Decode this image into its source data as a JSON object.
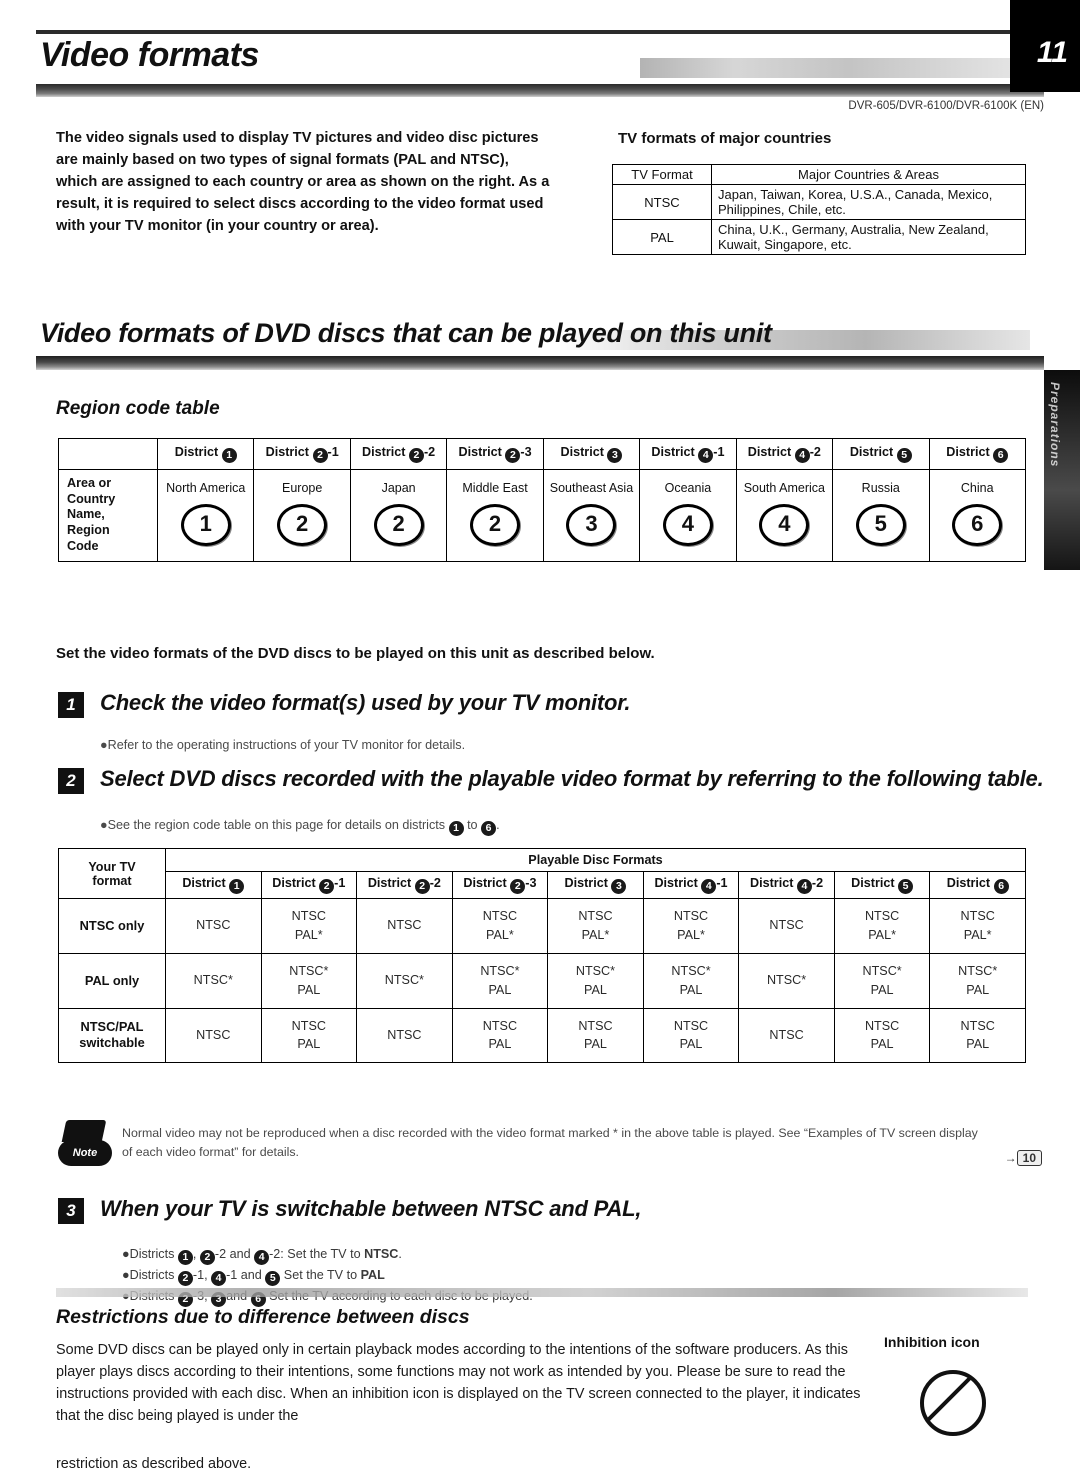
{
  "header": {
    "title": "Video formats",
    "page_number": "11",
    "model_line": "DVR-605/DVR-6100/DVR-6100K (EN)"
  },
  "intro": {
    "text": "The video signals used to display TV pictures and video disc pictures are mainly based on two types of signal formats (PAL and NTSC), which are assigned to each country or area as shown on the right. As a result, it is required to select discs according to the video format used with your TV monitor (in your country or area)."
  },
  "tv_formats": {
    "title": "TV formats of major countries",
    "headers": [
      "TV Format",
      "Major Countries & Areas"
    ],
    "rows": [
      {
        "format": "NTSC",
        "areas_line1": "Japan, Taiwan, Korea, U.S.A., Canada, Mexico,",
        "areas_line2": "Philippines, Chile, etc."
      },
      {
        "format": "PAL",
        "areas_line1": "China, U.K., Germany, Australia, New Zealand,",
        "areas_line2": "Kuwait, Singapore, etc."
      }
    ]
  },
  "banner": {
    "title": "Video formats of DVD discs that can be played on this unit"
  },
  "side_tab": {
    "label": "Preparations"
  },
  "region_table": {
    "heading": "Region code table",
    "row_label": "Area or Country Name, Region Code",
    "districts": [
      {
        "label": "District",
        "badge": "1",
        "sub": ""
      },
      {
        "label": "District",
        "badge": "2",
        "sub": "-1"
      },
      {
        "label": "District",
        "badge": "2",
        "sub": "-2"
      },
      {
        "label": "District",
        "badge": "2",
        "sub": "-3"
      },
      {
        "label": "District",
        "badge": "3",
        "sub": ""
      },
      {
        "label": "District",
        "badge": "4",
        "sub": "-1"
      },
      {
        "label": "District",
        "badge": "4",
        "sub": "-2"
      },
      {
        "label": "District",
        "badge": "5",
        "sub": ""
      },
      {
        "label": "District",
        "badge": "6",
        "sub": ""
      }
    ],
    "areas": [
      {
        "name": "North America",
        "code": "1"
      },
      {
        "name": "Europe",
        "code": "2"
      },
      {
        "name": "Japan",
        "code": "2"
      },
      {
        "name": "Middle East",
        "code": "2"
      },
      {
        "name": "Southeast Asia",
        "code": "3"
      },
      {
        "name": "Oceania",
        "code": "4"
      },
      {
        "name": "South America",
        "code": "4"
      },
      {
        "name": "Russia",
        "code": "5"
      },
      {
        "name": "China",
        "code": "6"
      }
    ]
  },
  "set_line": "Set the video formats of the DVD discs to be played on this unit as described below.",
  "steps": [
    {
      "num": "1",
      "title": "Check the video format(s) used by your TV monitor.",
      "bullet": "●Refer to the operating instructions of your TV monitor for details."
    },
    {
      "num": "2",
      "title": "Select DVD discs recorded with the playable video format by referring to the following table.",
      "bullet_prefix": "●See the region code table on this page for details on districts",
      "bullet_mid": "to",
      "bullet_from": "1",
      "bullet_to": "6",
      "bullet_suffix": "."
    },
    {
      "num": "3",
      "title": "When your TV is switchable between NTSC and PAL,"
    }
  ],
  "playable_table": {
    "corner_label_line1": "Your TV",
    "corner_label_line2": "format",
    "group_header": "Playable Disc Formats",
    "districts": [
      {
        "label": "District",
        "badge": "1",
        "sub": ""
      },
      {
        "label": "District",
        "badge": "2",
        "sub": "-1"
      },
      {
        "label": "District",
        "badge": "2",
        "sub": "-2"
      },
      {
        "label": "District",
        "badge": "2",
        "sub": "-3"
      },
      {
        "label": "District",
        "badge": "3",
        "sub": ""
      },
      {
        "label": "District",
        "badge": "4",
        "sub": "-1"
      },
      {
        "label": "District",
        "badge": "4",
        "sub": "-2"
      },
      {
        "label": "District",
        "badge": "5",
        "sub": ""
      },
      {
        "label": "District",
        "badge": "6",
        "sub": ""
      }
    ],
    "rows": [
      {
        "label": "NTSC only",
        "cells": [
          "NTSC",
          "NTSC\nPAL*",
          "NTSC",
          "NTSC\nPAL*",
          "NTSC\nPAL*",
          "NTSC\nPAL*",
          "NTSC",
          "NTSC\nPAL*",
          "NTSC\nPAL*"
        ]
      },
      {
        "label": "PAL only",
        "cells": [
          "NTSC*",
          "NTSC*\nPAL",
          "NTSC*",
          "NTSC*\nPAL",
          "NTSC*\nPAL",
          "NTSC*\nPAL",
          "NTSC*",
          "NTSC*\nPAL",
          "NTSC*\nPAL"
        ]
      },
      {
        "label": "NTSC/PAL\nswitchable",
        "cells": [
          "NTSC",
          "NTSC\nPAL",
          "NTSC",
          "NTSC\nPAL",
          "NTSC\nPAL",
          "NTSC\nPAL",
          "NTSC",
          "NTSC\nPAL",
          "NTSC\nPAL"
        ]
      }
    ]
  },
  "note": {
    "icon_label": "Note",
    "text": "Normal video may not be reproduced when a disc recorded with the video format marked * in the above table is played. See “Examples of TV screen display of each video format” for details.",
    "page_ref_arrow": "→",
    "page_ref": "10"
  },
  "step3_bullets": [
    {
      "prefix": "●Districts",
      "b1": "1",
      "sep1": ",",
      "b2": "2",
      "s2": "-2 and",
      "b3": "4",
      "s3": "-2: Set the TV to",
      "bold": "NTSC",
      "tail": "."
    },
    {
      "prefix": "●Districts",
      "b1": "2",
      "sep1": "-1,",
      "b2": "4",
      "s2": "-1 and",
      "b3": "5",
      "s3": "  Set the TV to",
      "bold": "PAL",
      "tail": ""
    },
    {
      "prefix": "●Districts",
      "b1": "2",
      "sep1": "-3,",
      "b2": "3",
      "s2": "and",
      "b3": "6",
      "s3": "  Set the TV according to each disc to be played.",
      "bold": "",
      "tail": ""
    }
  ],
  "restrictions": {
    "heading": "Restrictions due to difference between discs",
    "body": "Some DVD discs can be played only in certain playback modes according to the intentions of the software producers. As this player plays discs according to their intentions, some functions may not work as intended by you. Please be sure to read the instructions provided with each disc. When an inhibition icon is displayed on the TV screen connected to the player, it indicates that the disc being played is under the",
    "body_clipped": "restriction as described above.",
    "inhibition_title": "Inhibition icon"
  }
}
